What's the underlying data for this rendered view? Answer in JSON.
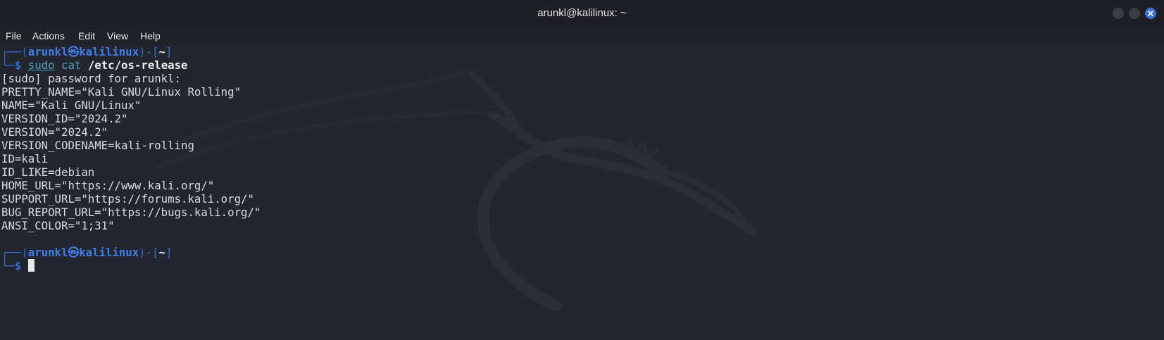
{
  "window": {
    "title": "arunkl@kalilinux: ~"
  },
  "menu": {
    "file": "File",
    "actions": "Actions",
    "edit": "Edit",
    "view": "View",
    "help": "Help"
  },
  "prompt": {
    "open_frame": "┌──(",
    "user": "arunkl",
    "at_symbol": "㉿",
    "host": "kalilinux",
    "mid_frame": ")-[",
    "path": "~",
    "close_frame": "]",
    "second_frame": "└─",
    "dollar": "$"
  },
  "command": {
    "sudo": "sudo",
    "cat": "cat",
    "arg": "/etc/os-release"
  },
  "output": [
    "[sudo] password for arunkl:",
    "PRETTY_NAME=\"Kali GNU/Linux Rolling\"",
    "NAME=\"Kali GNU/Linux\"",
    "VERSION_ID=\"2024.2\"",
    "VERSION=\"2024.2\"",
    "VERSION_CODENAME=kali-rolling",
    "ID=kali",
    "ID_LIKE=debian",
    "HOME_URL=\"https://www.kali.org/\"",
    "SUPPORT_URL=\"https://forums.kali.org/\"",
    "BUG_REPORT_URL=\"https://bugs.kali.org/\"",
    "ANSI_COLOR=\"1;31\""
  ],
  "colors": {
    "background": "#23262e",
    "prompt_blue": "#3d7ee9",
    "command_cyan": "#53a2bd",
    "close_button": "#3d6fd6"
  }
}
